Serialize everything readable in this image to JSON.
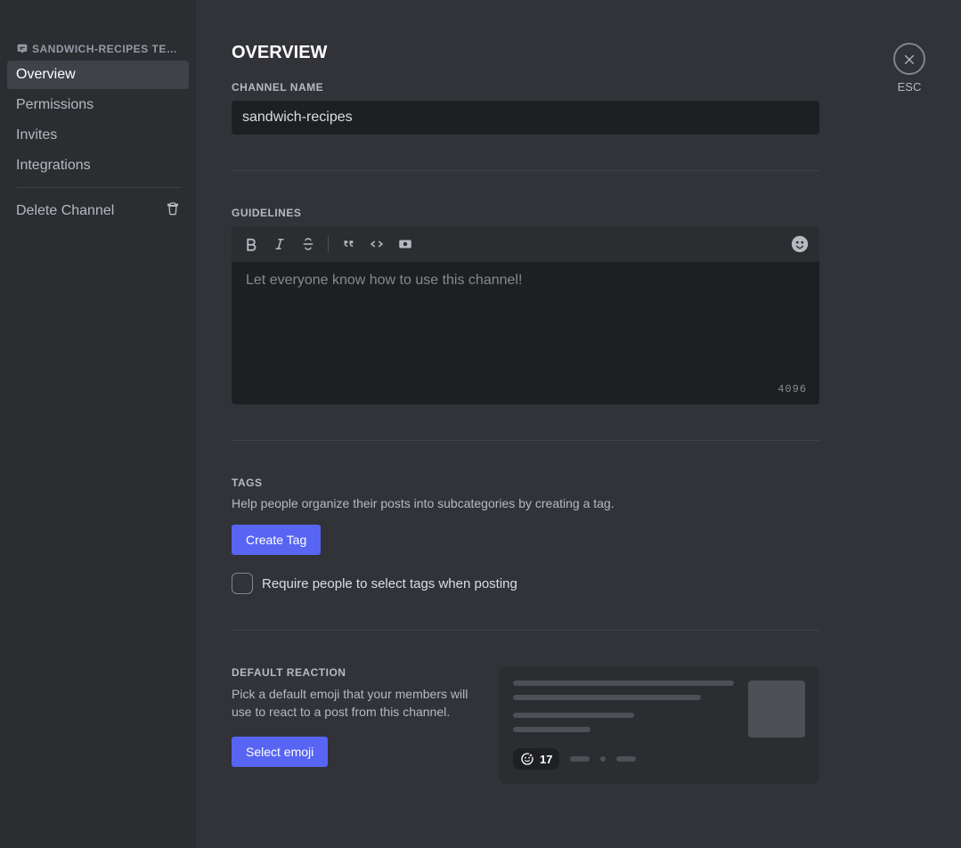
{
  "sidebar": {
    "header": "SANDWICH-RECIPES TE…",
    "items": [
      {
        "label": "Overview",
        "selected": true
      },
      {
        "label": "Permissions",
        "selected": false
      },
      {
        "label": "Invites",
        "selected": false
      },
      {
        "label": "Integrations",
        "selected": false
      }
    ],
    "delete_label": "Delete Channel"
  },
  "close": {
    "esc_label": "ESC"
  },
  "page": {
    "title": "Overview"
  },
  "channel_name": {
    "label": "Channel Name",
    "value": "sandwich-recipes"
  },
  "guidelines": {
    "label": "Guidelines",
    "placeholder": "Let everyone know how to use this channel!",
    "char_limit": "4096"
  },
  "tags": {
    "label": "Tags",
    "help": "Help people organize their posts into subcategories by creating a tag.",
    "create_button": "Create Tag",
    "require_label": "Require people to select tags when posting"
  },
  "default_reaction": {
    "label": "Default Reaction",
    "desc": "Pick a default emoji that your members will use to react to a post from this channel.",
    "select_button": "Select emoji",
    "preview_count": "17"
  }
}
